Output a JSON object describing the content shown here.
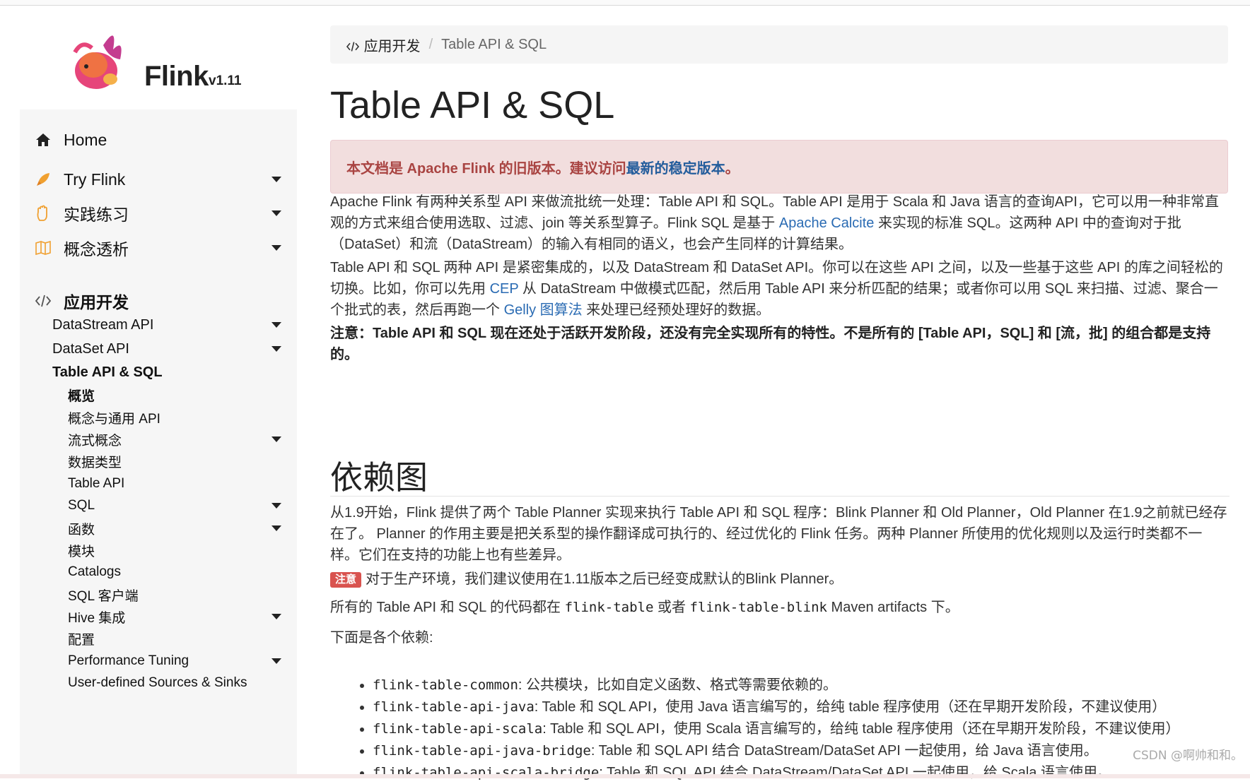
{
  "brand": {
    "name": "Flink",
    "version": "v1.11"
  },
  "sidebar": {
    "home": "Home",
    "sections": [
      {
        "label": "Try Flink",
        "icon": "rocket-icon"
      },
      {
        "label": "实践练习",
        "icon": "hand-icon"
      },
      {
        "label": "概念透析",
        "icon": "book-icon"
      }
    ],
    "dev": {
      "label": "应用开发",
      "items": [
        "DataStream API",
        "DataSet API",
        "Table API & SQL"
      ],
      "table_items": [
        "概览",
        "概念与通用 API",
        "流式概念",
        "数据类型",
        "Table API",
        "SQL",
        "函数",
        "模块",
        "Catalogs",
        "SQL 客户端",
        "Hive 集成",
        "配置",
        "Performance Tuning",
        "User-defined Sources & Sinks"
      ]
    }
  },
  "breadcrumb": {
    "parent": "应用开发",
    "sep": "/",
    "current": "Table API & SQL"
  },
  "title": "Table API & SQL",
  "alert": {
    "text": "本文档是 Apache Flink 的旧版本。建议访问 ",
    "link": "最新的稳定版本",
    "tail": "。"
  },
  "para1": {
    "a": "Apache Flink 有两种关系型 API 来做流批统一处理：Table API 和 SQL。Table API 是用于 Scala 和 Java 语言的查询API，它可以用一种非常直观的方式来组合使用选取、过滤、join 等关系型算子。Flink SQL 是基于 ",
    "link": "Apache Calcite",
    "b": " 来实现的标准 SQL。这两种 API 中的查询对于批（DataSet）和流（DataStream）的输入有相同的语义，也会产生同样的计算结果。"
  },
  "para2": {
    "a": "Table API 和 SQL 两种 API 是紧密集成的，以及 DataStream 和 DataSet API。你可以在这些 API 之间，以及一些基于这些 API 的库之间轻松的切换。比如，你可以先用 ",
    "link1": "CEP",
    "b": " 从 DataStream 中做模式匹配，然后用 Table API 来分析匹配的结果；或者你可以用 SQL 来扫描、过滤、聚合一个批式的表，然后再跑一个 ",
    "link2": "Gelly 图算法",
    "c": " 来处理已经预处理好的数据。"
  },
  "para3": "注意：Table API 和 SQL 现在还处于活跃开发阶段，还没有完全实现所有的特性。不是所有的 [Table API，SQL] 和 [流，批] 的组合都是支持的。",
  "section": {
    "title": "依赖图"
  },
  "para4": "从1.9开始，Flink 提供了两个 Table Planner 实现来执行 Table API 和 SQL 程序：Blink Planner 和 Old Planner，Old Planner 在1.9之前就已经存在了。 Planner 的作用主要是把关系型的操作翻译成可执行的、经过优化的 Flink 任务。两种 Planner 所使用的优化规则以及运行时类都不一样。它们在支持的功能上也有些差异。",
  "note": {
    "badge": "注意",
    "text": "对于生产环境，我们建议使用在1.11版本之后已经变成默认的Blink Planner。"
  },
  "para5": {
    "a": "所有的 Table API 和 SQL 的代码都在 ",
    "code1": "flink-table",
    "b": " 或者 ",
    "code2": "flink-table-blink",
    "c": " Maven artifacts 下。"
  },
  "para6": "下面是各个依赖:",
  "deps": [
    {
      "code": "flink-table-common",
      "desc": ": 公共模块，比如自定义函数、格式等需要依赖的。"
    },
    {
      "code": "flink-table-api-java",
      "desc": ": Table 和 SQL API，使用 Java 语言编写的，给纯 table 程序使用（还在早期开发阶段，不建议使用）"
    },
    {
      "code": "flink-table-api-scala",
      "desc": ": Table 和 SQL API，使用 Scala 语言编写的，给纯 table 程序使用（还在早期开发阶段，不建议使用）"
    },
    {
      "code": "flink-table-api-java-bridge",
      "desc": ": Table 和 SQL API 结合 DataStream/DataSet API 一起使用，给 Java 语言使用。"
    },
    {
      "code": "flink-table-api-scala-bridge",
      "desc": ": Table 和 SQL API 结合 DataStream/DataSet API 一起使用，给 Scala 语言使用。"
    }
  ],
  "watermark": "CSDN @啊帅和和。"
}
